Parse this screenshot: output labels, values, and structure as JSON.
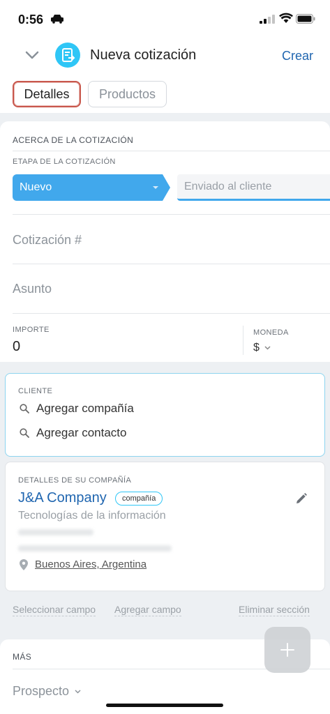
{
  "status": {
    "time": "0:56"
  },
  "header": {
    "title": "Nueva cotización",
    "create_label": "Crear"
  },
  "tabs": [
    {
      "label": "Detalles",
      "active": true
    },
    {
      "label": "Productos",
      "active": false
    }
  ],
  "about": {
    "section_title": "ACERCA DE LA COTIZACIÓN",
    "stage_label": "ETAPA DE LA COTIZACIÓN",
    "stage_current": "Nuevo",
    "stage_next": "Enviado al cliente",
    "quote_number_placeholder": "Cotización #",
    "subject_placeholder": "Asunto",
    "amount_label": "IMPORTE",
    "amount_value": "0",
    "currency_label": "MONEDA",
    "currency_value": "$"
  },
  "client": {
    "label": "CLIENTE",
    "add_company": "Agregar compañía",
    "add_contact": "Agregar contacto"
  },
  "company": {
    "label": "DETALLES DE SU COMPAÑÍA",
    "name": "J&A Company",
    "badge": "compañía",
    "industry": "Tecnologías de la información",
    "location": "Buenos Aires, Argentina"
  },
  "footer": {
    "select_field": "Seleccionar campo",
    "add_field": "Agregar campo",
    "delete_section": "Eliminar sección"
  },
  "more": {
    "section_title": "MÁS",
    "prospect": "Prospecto"
  },
  "colors": {
    "accent": "#2fc6f6",
    "stage_blue": "#41a8ec",
    "link_blue": "#2066b0",
    "active_tab_border": "#c8574c"
  }
}
